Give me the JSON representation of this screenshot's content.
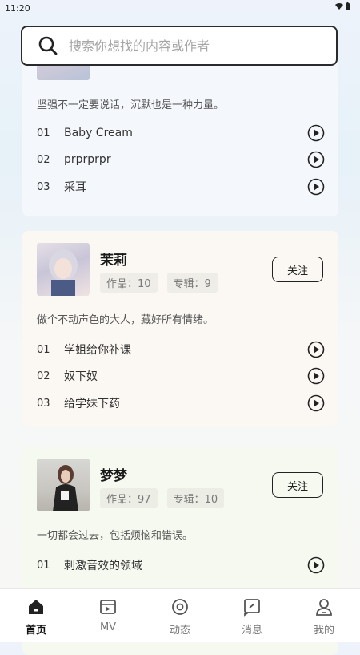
{
  "status_bar": {
    "time": "11:20"
  },
  "search": {
    "placeholder": "搜索你想找的内容或作者"
  },
  "cards": [
    {
      "description": "坚强不一定要说话，沉默也是一种力量。",
      "songs": [
        {
          "num": "01",
          "title": "Baby Cream"
        },
        {
          "num": "02",
          "title": "prprprpr"
        },
        {
          "num": "03",
          "title": "采耳"
        }
      ]
    },
    {
      "name": "茉莉",
      "works": "作品：10",
      "albums": "专辑：9",
      "follow": "关注",
      "description": "做个不动声色的大人，藏好所有情绪。",
      "songs": [
        {
          "num": "01",
          "title": "学姐给你补课"
        },
        {
          "num": "02",
          "title": "奴下奴"
        },
        {
          "num": "03",
          "title": "给学妹下药"
        }
      ]
    },
    {
      "name": "梦梦",
      "works": "作品：97",
      "albums": "专辑：10",
      "follow": "关注",
      "description": "一切都会过去，包括烦恼和错误。",
      "songs": [
        {
          "num": "01",
          "title": "刺激音效的领域"
        }
      ]
    }
  ],
  "tabs": [
    {
      "label": "首页",
      "icon": "home-icon",
      "active": true
    },
    {
      "label": "MV",
      "icon": "video-icon",
      "active": false
    },
    {
      "label": "动态",
      "icon": "target-icon",
      "active": false
    },
    {
      "label": "消息",
      "icon": "message-icon",
      "active": false
    },
    {
      "label": "我的",
      "icon": "profile-icon",
      "active": false
    }
  ],
  "colors": {
    "accent": "#222222",
    "background": "#f4f7fb"
  }
}
